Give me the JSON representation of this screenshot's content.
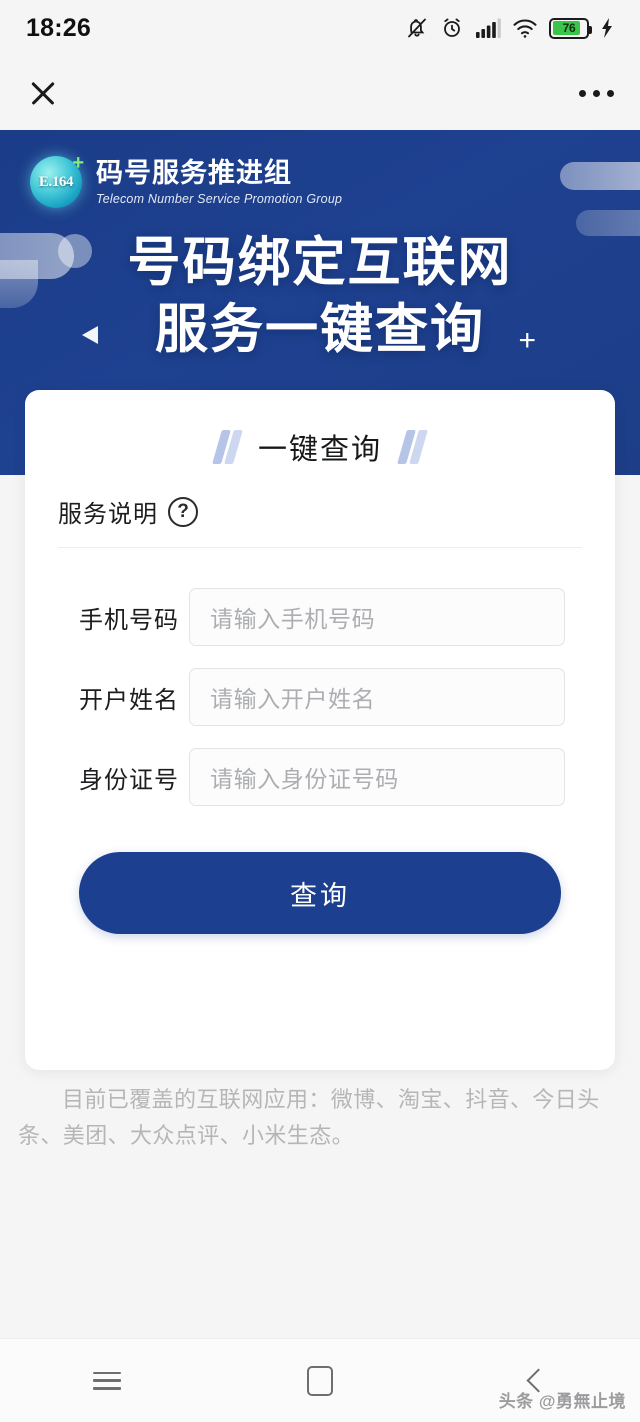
{
  "status_bar": {
    "time": "18:26",
    "icons": [
      "bell-muted-icon",
      "alarm-icon",
      "signal-icon",
      "wifi-icon",
      "battery-icon",
      "charging-bolt-icon"
    ],
    "battery_percent": "76"
  },
  "app_bar": {
    "close_label": "close-icon",
    "more_label": "more-options-icon"
  },
  "banner": {
    "brand_cn": "码号服务推进组",
    "brand_en": "Telecom Number Service  Promotion Group",
    "logo_text": "E.164",
    "logo_plus": "+",
    "headline_line1": "号码绑定互联网",
    "headline_line2": "服务一键查询",
    "headline_plus": "+",
    "bg_color": "#1e4190"
  },
  "card": {
    "title": "一键查询",
    "service_note_label": "服务说明",
    "help_icon_text": "?",
    "fields": [
      {
        "label": "手机号码",
        "placeholder": "请输入手机号码",
        "value": ""
      },
      {
        "label": "开户姓名",
        "placeholder": "请输入开户姓名",
        "value": ""
      },
      {
        "label": "身份证号",
        "placeholder": "请输入身份证号码",
        "value": ""
      }
    ],
    "submit_label": "查询",
    "submit_color": "#1c3f8f"
  },
  "footer_note": "目前已覆盖的互联网应用：微博、淘宝、抖音、今日头条、美团、大众点评、小米生态。",
  "nav_bar": {
    "recents_label": "recents-icon",
    "home_label": "home-icon",
    "back_label": "back-icon"
  },
  "watermark": "头条 @勇無止境"
}
